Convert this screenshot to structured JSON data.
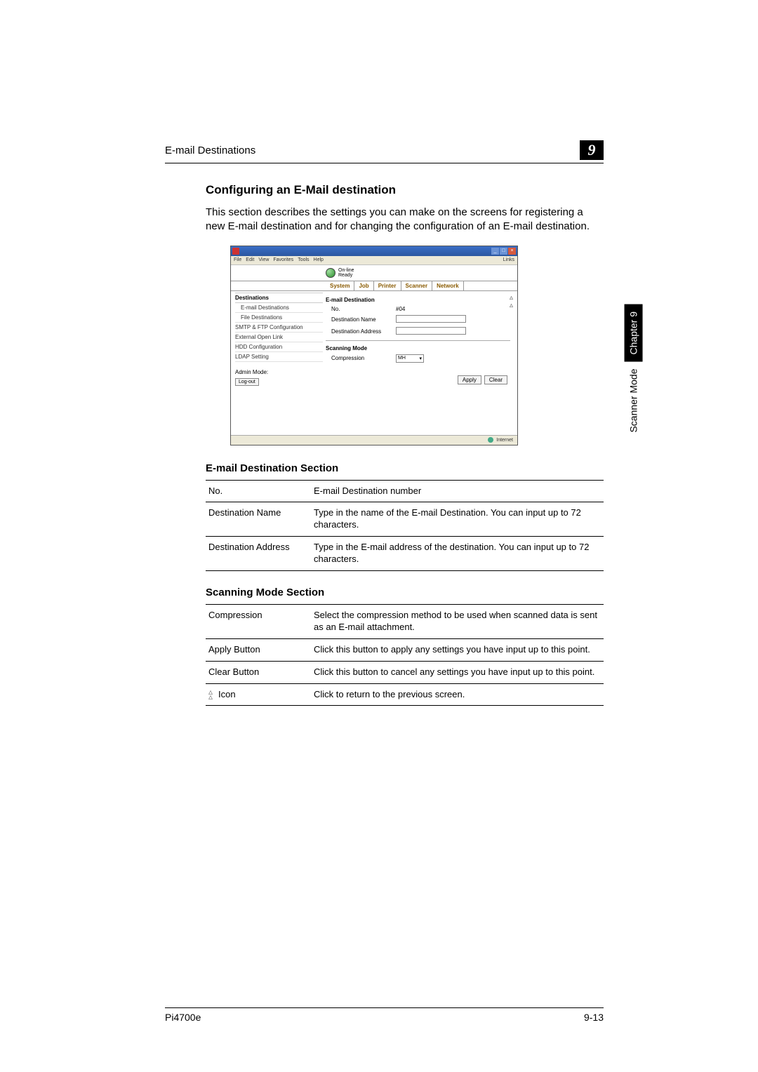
{
  "header": {
    "title": "E-mail Destinations",
    "chapter_num": "9"
  },
  "side": {
    "label": "Scanner Mode",
    "chapter": "Chapter 9"
  },
  "section": {
    "title": "Configuring an E-Mail destination",
    "intro": "This section describes the settings you can make on the screens for registering a new E-mail destination and for changing the configuration of an E-mail destination."
  },
  "screenshot": {
    "menus": [
      "File",
      "Edit",
      "View",
      "Favorites",
      "Tools",
      "Help"
    ],
    "links_label": "Links",
    "status": {
      "line1": "On-line",
      "line2": "Ready"
    },
    "tabs": [
      "System",
      "Job",
      "Printer",
      "Scanner",
      "Network"
    ],
    "sidebar": {
      "head": "Destinations",
      "items": [
        "E-mail Destinations",
        "File Destinations",
        "SMTP & FTP Configuration",
        "External Open Link",
        "HDD Configuration",
        "LDAP Setting"
      ],
      "admin": "Admin Mode:",
      "logout": "Log-out"
    },
    "form": {
      "group1_title": "E-mail Destination",
      "no_label": "No.",
      "no_value": "#04",
      "name_label": "Destination Name",
      "addr_label": "Destination Address",
      "group2_title": "Scanning Mode",
      "comp_label": "Compression",
      "comp_value": "MH",
      "apply": "Apply",
      "clear": "Clear"
    },
    "footer": "Internet"
  },
  "table1": {
    "title": "E-mail Destination Section",
    "rows": [
      {
        "k": "No.",
        "v": "E-mail Destination number"
      },
      {
        "k": "Destination Name",
        "v": "Type in the name of the E-mail Destination. You can input up to 72 characters."
      },
      {
        "k": "Destination Address",
        "v": "Type in the E-mail address of the destination. You can input up to 72 characters."
      }
    ]
  },
  "table2": {
    "title": "Scanning Mode Section",
    "rows": [
      {
        "k": "Compression",
        "v": "Select the compression method to be used when scanned data is sent as an E-mail attachment."
      },
      {
        "k": "Apply Button",
        "v": "Click this button to apply any settings you have input up to this point."
      },
      {
        "k": "Clear Button",
        "v": "Click this button to cancel any settings you have input up to this point."
      },
      {
        "k": "Icon",
        "v": "Click to return to the previous screen.",
        "icon": true
      }
    ]
  },
  "footer": {
    "left": "Pi4700e",
    "right": "9-13"
  }
}
